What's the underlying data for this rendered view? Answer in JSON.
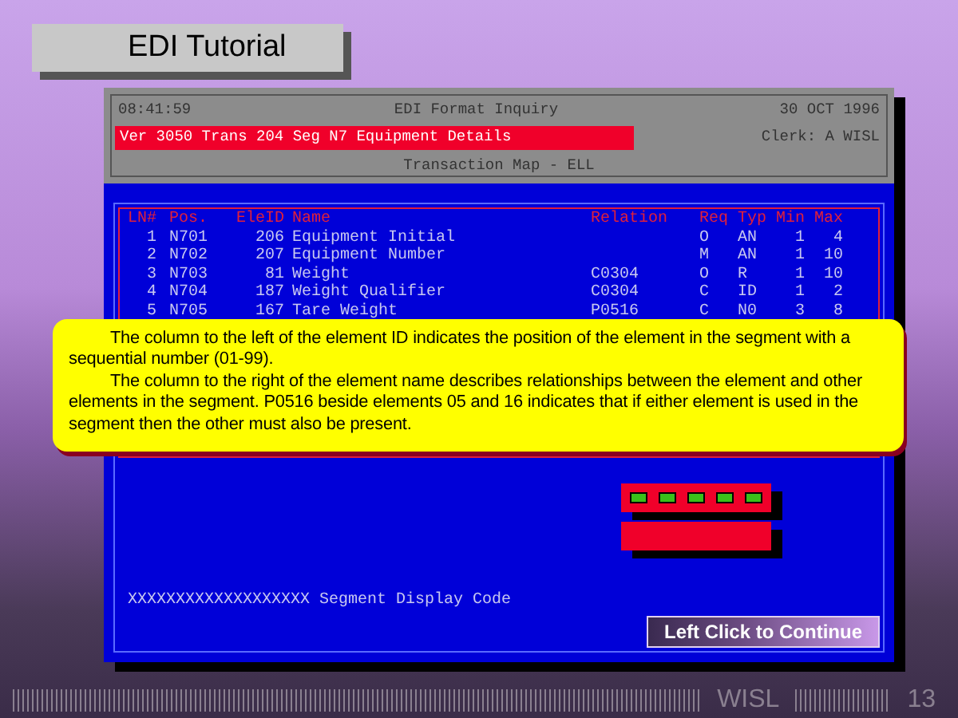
{
  "title": "EDI Tutorial",
  "terminal": {
    "time": "08:41:59",
    "heading": "EDI Format Inquiry",
    "date": "30 OCT 1996",
    "segment_bar": "Ver 3050 Trans 204 Seg N7 Equipment Details",
    "clerk": "Clerk: A WISL",
    "subheading": "Transaction Map - ELL",
    "table": {
      "columns": [
        "LN#",
        "Pos.",
        "EleID",
        "Name",
        "Relation",
        "Req",
        "Typ",
        "Min",
        "Max"
      ],
      "rows": [
        [
          "1",
          "N701",
          "206",
          "Equipment Initial",
          "",
          "O",
          "AN",
          "1",
          "4"
        ],
        [
          "2",
          "N702",
          "207",
          "Equipment Number",
          "",
          "M",
          "AN",
          "1",
          "10"
        ],
        [
          "3",
          "N703",
          "81",
          "Weight",
          "C0304",
          "O",
          "R",
          "1",
          "10"
        ],
        [
          "4",
          "N704",
          "187",
          "Weight Qualifier",
          "C0304",
          "C",
          "ID",
          "1",
          "2"
        ],
        [
          "5",
          "N705",
          "167",
          "Tare Weight",
          "P0516",
          "C",
          "N0",
          "3",
          "8"
        ]
      ]
    },
    "footer_code": "XXXXXXXXXXXXXXXXXXX Segment Display Code"
  },
  "callout": {
    "paragraphs": [
      "The column to the left of the element ID indicates the position of the element in the segment with a sequential number (01-99).",
      "The column to the right of the element name describes relationships between the element and other elements in the segment. P0516 beside elements 05 and 16 indicates that if either element is used in the segment then the other must also be present."
    ]
  },
  "continue_button": "Left Click to Continue",
  "footer": {
    "brand": "WISL",
    "page": "13"
  }
}
